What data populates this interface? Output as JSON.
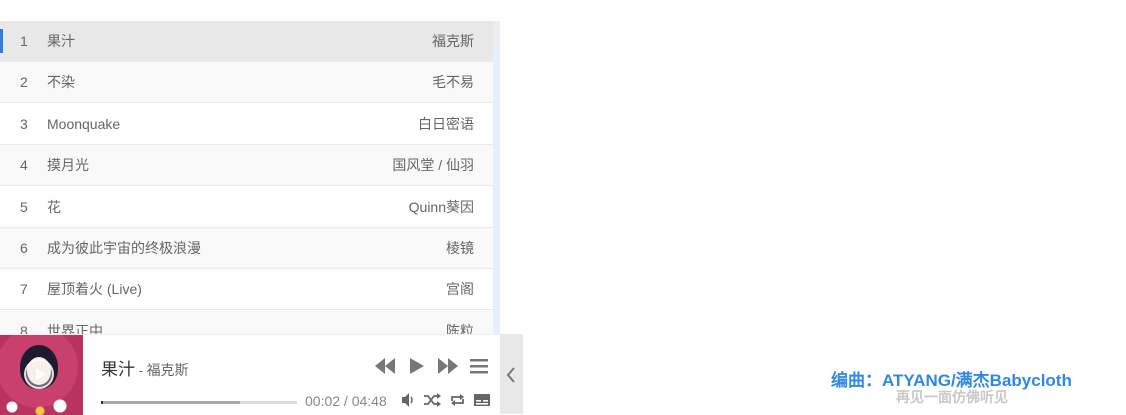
{
  "playlist": {
    "items": [
      {
        "index": "1",
        "title": "果汁",
        "artist": "福克斯"
      },
      {
        "index": "2",
        "title": "不染",
        "artist": "毛不易"
      },
      {
        "index": "3",
        "title": "Moonquake",
        "artist": "白日密语"
      },
      {
        "index": "4",
        "title": "摸月光",
        "artist": "国风堂 / 仙羽"
      },
      {
        "index": "5",
        "title": "花",
        "artist": "Quinn葵因"
      },
      {
        "index": "6",
        "title": "成为彼此宇宙的终极浪漫",
        "artist": "棱镜"
      },
      {
        "index": "7",
        "title": "屋顶着火 (Live)",
        "artist": "宫阁"
      },
      {
        "index": "8",
        "title": "世界正中",
        "artist": "陈粒"
      }
    ],
    "active_index": 0
  },
  "player": {
    "title": "果汁",
    "separator": " - ",
    "artist": "福克斯",
    "time": "00:02 / 04:48",
    "played_fraction": 0.007,
    "loaded_fraction": 0.71,
    "icons": {
      "prev": "skip-back-icon",
      "play": "play-icon",
      "next": "skip-forward-icon",
      "menu": "list-menu-icon",
      "volume": "volume-icon",
      "shuffle": "shuffle-icon",
      "loop": "loop-icon",
      "lyrics": "lyrics-icon",
      "collapse": "chevron-left-icon"
    },
    "accent_color": "#2f7fd6"
  },
  "lyrics": {
    "current": "编曲：ATYANG/满杰Babycloth",
    "next": "再见一面仿佛听见"
  }
}
